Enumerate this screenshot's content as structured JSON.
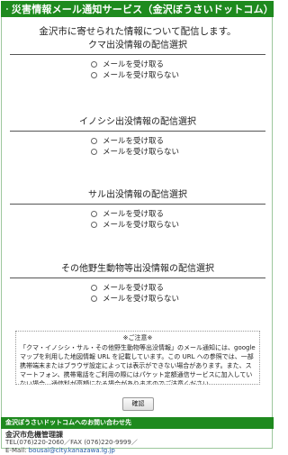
{
  "header": {
    "title": "災害情報メール通知サービス（金沢ぼうさいドットコム）",
    "icon": "mail-icon"
  },
  "intro": "金沢市に寄せられた情報について配信します。",
  "sections": [
    {
      "title": "クマ出没情報の配信選択",
      "options": [
        "メールを受け取る",
        "メールを受け取らない"
      ]
    },
    {
      "title": "イノシシ出没情報の配信選択",
      "options": [
        "メールを受け取る",
        "メールを受け取らない"
      ]
    },
    {
      "title": "サル出没情報の配信選択",
      "options": [
        "メールを受け取る",
        "メールを受け取らない"
      ]
    },
    {
      "title": "その他野生動物等出没情報の配信選択",
      "options": [
        "メールを受け取る",
        "メールを受け取らない"
      ]
    }
  ],
  "note": {
    "heading": "※ご注意※",
    "body": "「クマ・イノシシ・サル・その他野生動物等出没情報」のメール通知には、google マップを利用した地図情報 URL を記載しています。この URL への参照では、一部携帯端末またはブラウザ設定によっては表示ができない場合があります。また、スマートフォン、携帯電話をご利用の際にはパケット定額通信サービスに加入していない場合、通信料が高額になる場合がありますのでご注意ください。"
  },
  "confirm_label": "確認",
  "footer": {
    "bar": "金沢ぼうさいドットコムへのお問い合わせ先",
    "org": "金沢市危機管理課",
    "tel": "TEL(076)220-2060／FAX (076)220-9999／",
    "email_label": "E-Mail:",
    "email": "bousai@city.kanazawa.lg.jp"
  },
  "colors": {
    "header_green": "#1e8a1e",
    "link_blue": "#225aa8"
  }
}
